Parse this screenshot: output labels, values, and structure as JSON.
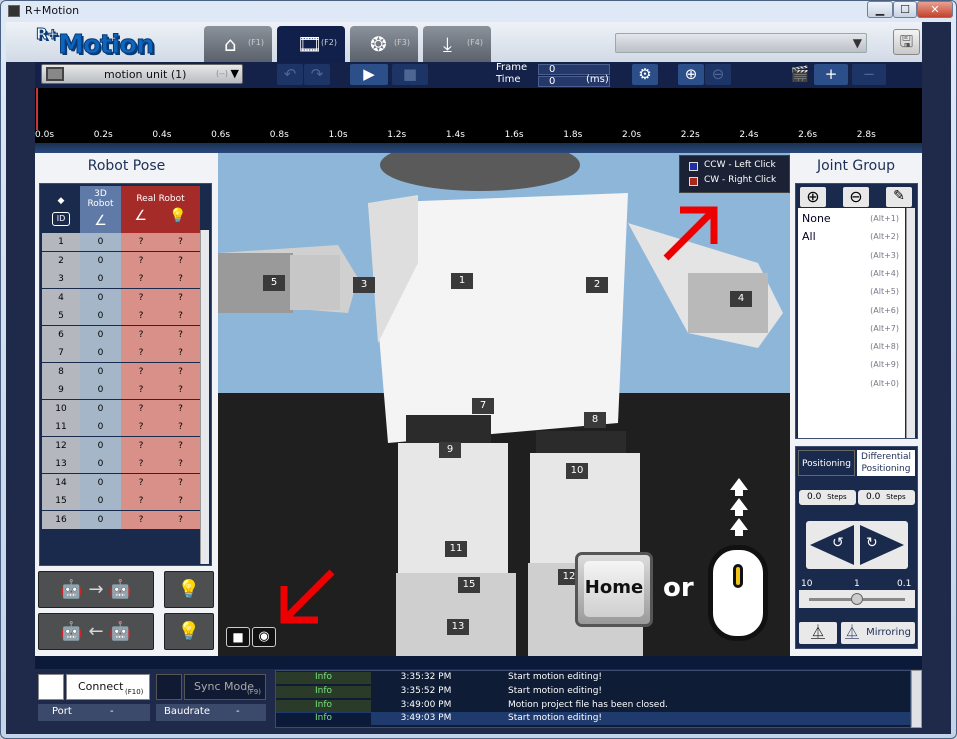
{
  "window": {
    "title": "R+Motion",
    "min": "▁",
    "max": "☐",
    "close": "✕"
  },
  "app": {
    "logo": "Motion",
    "logo_sup": "R+"
  },
  "tabs": [
    {
      "icon": "home-icon",
      "glyph": "⌂",
      "key": "(F1)"
    },
    {
      "icon": "film-icon",
      "glyph": "🎞",
      "key": "(F2)"
    },
    {
      "icon": "reel-icon",
      "glyph": "❂",
      "key": "(F3)"
    },
    {
      "icon": "download-icon",
      "glyph": "⤓",
      "key": "(F4)"
    }
  ],
  "toolbar": {
    "motion_unit": "motion unit (1)",
    "motion_unit_sub": "(--)",
    "frame_label": "Frame",
    "frame_value": "0",
    "time_label": "Time",
    "time_value": "0",
    "time_unit": "(ms)"
  },
  "ruler": [
    "0.0s",
    "0.2s",
    "0.4s",
    "0.6s",
    "0.8s",
    "1.0s",
    "1.2s",
    "1.4s",
    "1.6s",
    "1.8s",
    "2.0s",
    "2.2s",
    "2.4s",
    "2.6s",
    "2.8s"
  ],
  "robot_pose": {
    "title": "Robot Pose",
    "col_id_icon": "◆",
    "col_id": "ID",
    "col_3d": "3D Robot",
    "col_real": "Real Robot",
    "rows": [
      {
        "id": "1",
        "v3d": "0",
        "r1": "?",
        "r2": "?"
      },
      {
        "id": "2",
        "v3d": "0",
        "r1": "?",
        "r2": "?"
      },
      {
        "id": "3",
        "v3d": "0",
        "r1": "?",
        "r2": "?"
      },
      {
        "id": "4",
        "v3d": "0",
        "r1": "?",
        "r2": "?"
      },
      {
        "id": "5",
        "v3d": "0",
        "r1": "?",
        "r2": "?"
      },
      {
        "id": "6",
        "v3d": "0",
        "r1": "?",
        "r2": "?"
      },
      {
        "id": "7",
        "v3d": "0",
        "r1": "?",
        "r2": "?"
      },
      {
        "id": "8",
        "v3d": "0",
        "r1": "?",
        "r2": "?"
      },
      {
        "id": "9",
        "v3d": "0",
        "r1": "?",
        "r2": "?"
      },
      {
        "id": "10",
        "v3d": "0",
        "r1": "?",
        "r2": "?"
      },
      {
        "id": "11",
        "v3d": "0",
        "r1": "?",
        "r2": "?"
      },
      {
        "id": "12",
        "v3d": "0",
        "r1": "?",
        "r2": "?"
      },
      {
        "id": "13",
        "v3d": "0",
        "r1": "?",
        "r2": "?"
      },
      {
        "id": "14",
        "v3d": "0",
        "r1": "?",
        "r2": "?"
      },
      {
        "id": "15",
        "v3d": "0",
        "r1": "?",
        "r2": "?"
      },
      {
        "id": "16",
        "v3d": "0",
        "r1": "?",
        "r2": "?"
      }
    ]
  },
  "legend": {
    "ccw": "CCW  - Left Click",
    "cw": "CW    - Right Click",
    "ccw_color": "#1f2fa8",
    "cw_color": "#a8281f"
  },
  "badges": [
    "5",
    "3",
    "1",
    "2",
    "4",
    "7",
    "8",
    "9",
    "10",
    "11",
    "15",
    "12",
    "13"
  ],
  "overlay": {
    "home_key": "Home",
    "or": "or"
  },
  "joint_group": {
    "title": "Joint Group",
    "items": [
      {
        "label": "None",
        "key": "(Alt+1)"
      },
      {
        "label": "All",
        "key": "(Alt+2)"
      },
      {
        "label": "",
        "key": "(Alt+3)"
      },
      {
        "label": "",
        "key": "(Alt+4)"
      },
      {
        "label": "",
        "key": "(Alt+5)"
      },
      {
        "label": "",
        "key": "(Alt+6)"
      },
      {
        "label": "",
        "key": "(Alt+7)"
      },
      {
        "label": "",
        "key": "(Alt+8)"
      },
      {
        "label": "",
        "key": "(Alt+9)"
      },
      {
        "label": "",
        "key": "(Alt+0)"
      }
    ]
  },
  "positioning": {
    "tab1": "Positioning",
    "tab2": "Differential Positioning",
    "val1": "0.0",
    "val2": "0.0",
    "steps": "Steps",
    "scale_left": "10",
    "scale_mid": "1",
    "scale_right": "0.1",
    "slider_value": 0.5,
    "mirroring": "Mirroring"
  },
  "connection": {
    "connect": "Connect",
    "connect_key": "(F10)",
    "sync": "Sync Mode",
    "sync_key": "(F9)",
    "port": "Port",
    "port_value": "-",
    "baudrate": "Baudrate",
    "baud_value": "-"
  },
  "log": [
    {
      "level": "Info",
      "time": "3:35:32 PM",
      "msg": "Start motion editing!"
    },
    {
      "level": "Info",
      "time": "3:35:52 PM",
      "msg": "Start motion editing!"
    },
    {
      "level": "Info",
      "time": "3:49:00 PM",
      "msg": "Motion project file has been closed."
    },
    {
      "level": "Info",
      "time": "3:49:03 PM",
      "msg": "Start motion editing!"
    }
  ]
}
